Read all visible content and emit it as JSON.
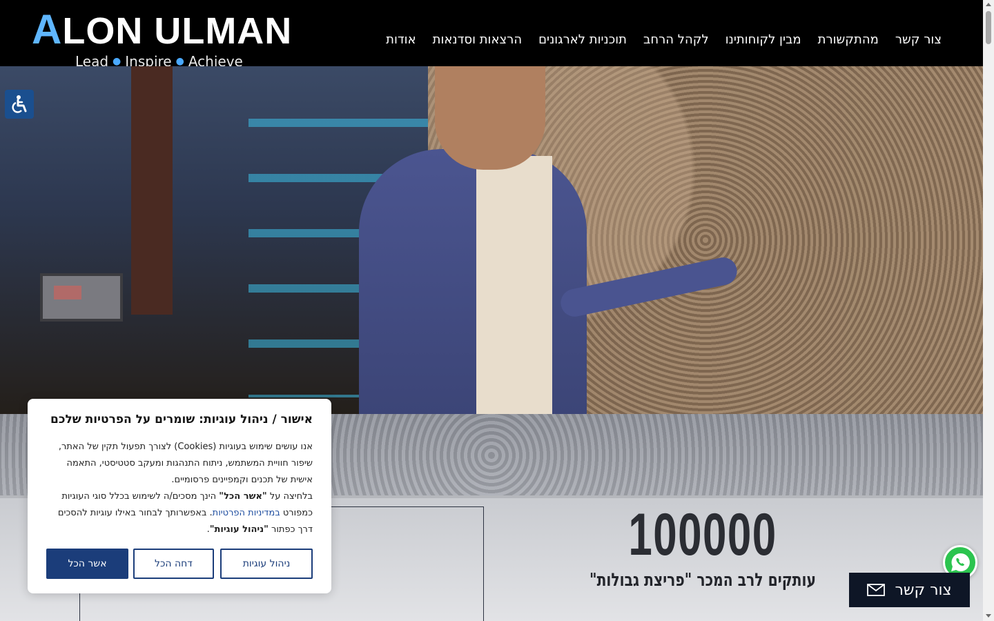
{
  "logo": {
    "accent_letter": "A",
    "rest": "LON ULMAN",
    "tagline": [
      "Lead",
      "Inspire",
      "Achieve"
    ]
  },
  "nav": {
    "items": [
      {
        "label": "אודות"
      },
      {
        "label": "הרצאות וסדנאות"
      },
      {
        "label": "תוכניות לארגונים"
      },
      {
        "label": "לקהל הרחב"
      },
      {
        "label": "מבין לקוחותינו"
      },
      {
        "label": "מהתקשורת"
      },
      {
        "label": "צור קשר"
      }
    ]
  },
  "stats": {
    "number": "100000",
    "caption": "עותקים לרב המכר \"פריצת גבולות\""
  },
  "cookie": {
    "title": "אישור / ניהול עוגיות: שומרים על הפרטיות שלכם",
    "para1": "אנו עושים שימוש בעוגיות (Cookies) לצורך תפעול תקין של האתר, שיפור חוויית המשתמש, ניתוח התנהגות ומעקב סטטיסטי, התאמה אישית של תכנים וקמפיינים פרסומיים.",
    "para2_a": "בלחיצה על ",
    "para2_accept_quote": "\"אשר הכל\"",
    "para2_b": " הינך מסכים/ה לשימוש בכלל סוגי העוגיות כמפורט ",
    "para2_link": "במדיניות הפרטיות",
    "para2_c": ". באפשרותך לבחור באילו עוגיות להסכים דרך כפתור ",
    "para2_manage_quote": "\"ניהול עוגיות\"",
    "para2_d": ".",
    "buttons": {
      "manage": "ניהול עוגיות",
      "reject": "דחה הכל",
      "accept": "אשר הכל"
    }
  },
  "contact": {
    "label": "צור קשר"
  },
  "colors": {
    "header_bg": "#000000",
    "logo_accent": "#5fb6ff",
    "cookie_primary": "#1b3d7a",
    "whatsapp": "#2cc44f",
    "contact_bg": "#0e1626",
    "a11y": "#1a4f8f"
  },
  "icons": {
    "accessibility": "wheelchair-icon",
    "whatsapp": "whatsapp-icon",
    "contact": "envelope-icon"
  }
}
